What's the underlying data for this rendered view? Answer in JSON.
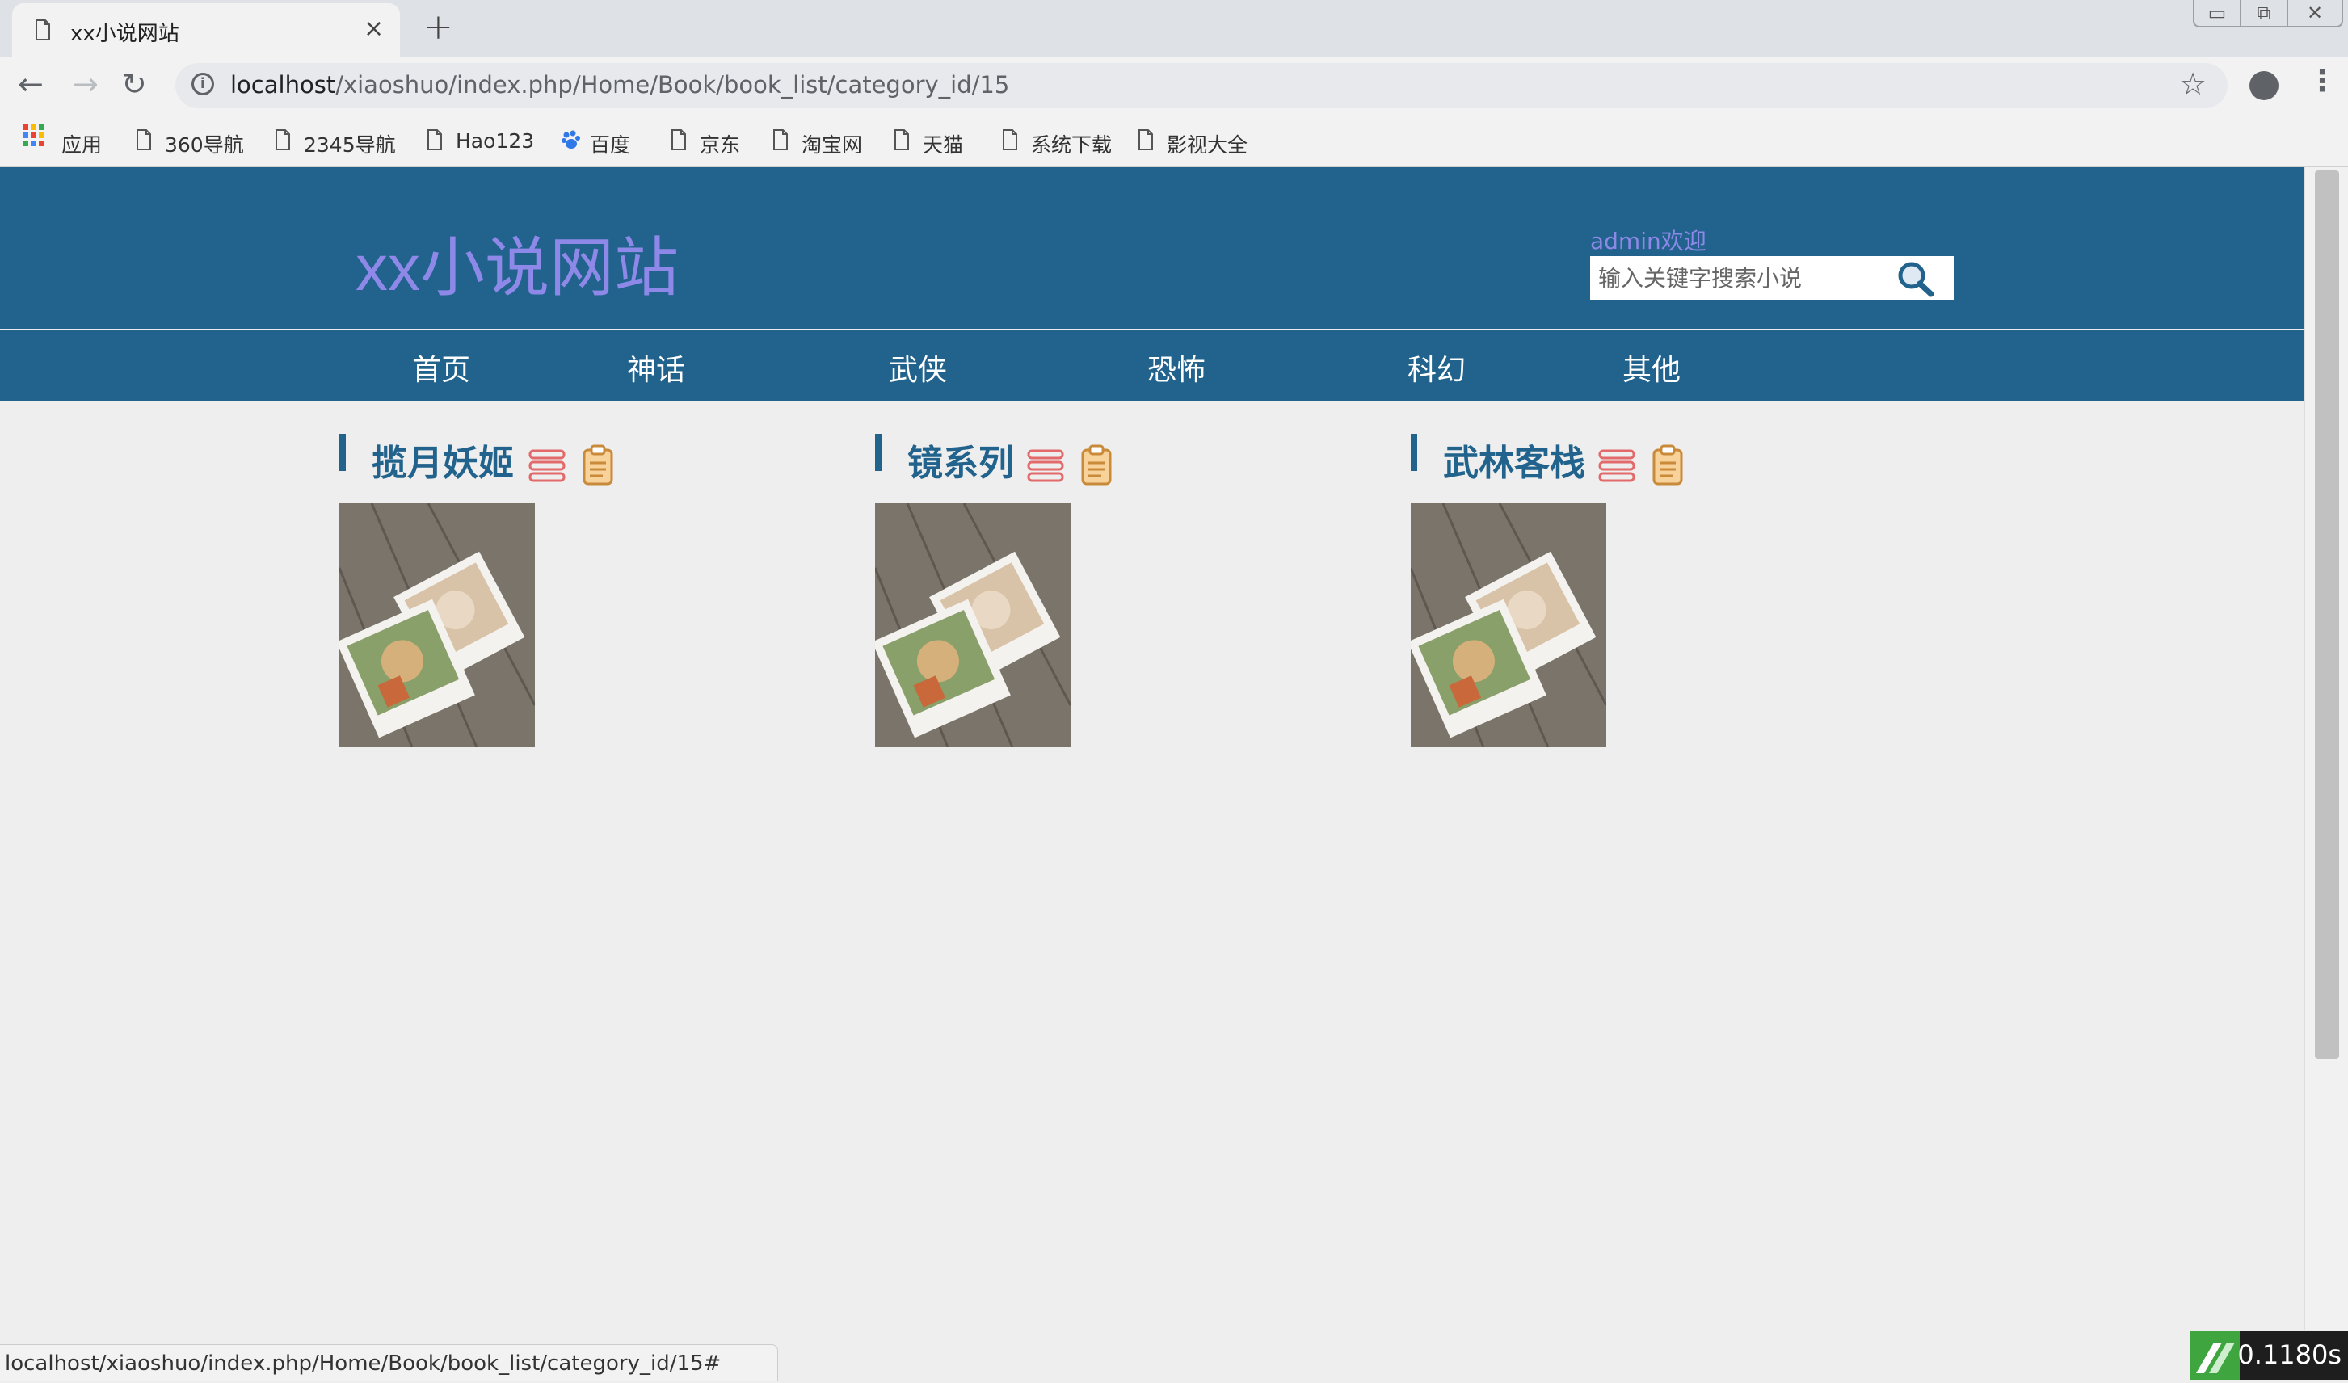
{
  "browser": {
    "tab_title": "xx小说网站",
    "tab_close": "×",
    "new_tab": "+",
    "url_host": "localhost",
    "url_path": "/xiaoshuo/index.php/Home/Book/book_list/category_id/15",
    "bookmarks": [
      {
        "label": "应用",
        "icon": "apps-grid-icon"
      },
      {
        "label": "360导航",
        "icon": "page-icon"
      },
      {
        "label": "2345导航",
        "icon": "page-icon"
      },
      {
        "label": "Hao123",
        "icon": "page-icon"
      },
      {
        "label": "百度",
        "icon": "baidu-paw-icon"
      },
      {
        "label": "京东",
        "icon": "page-icon"
      },
      {
        "label": "淘宝网",
        "icon": "page-icon"
      },
      {
        "label": "天猫",
        "icon": "page-icon"
      },
      {
        "label": "系统下载",
        "icon": "page-icon"
      },
      {
        "label": "影视大全",
        "icon": "page-icon"
      }
    ]
  },
  "site": {
    "title": "xx小说网站",
    "welcome": "admin欢迎",
    "search_placeholder": "输入关键字搜索小说",
    "nav": [
      "首页",
      "神话",
      "武侠",
      "恐怖",
      "科幻",
      "其他"
    ],
    "books": [
      {
        "title": "揽月妖姬"
      },
      {
        "title": "镜系列"
      },
      {
        "title": "武林客栈"
      }
    ]
  },
  "status": {
    "link_url": "localhost/xiaoshuo/index.php/Home/Book/book_list/category_id/15#",
    "timer": "0.1180s"
  },
  "colors": {
    "header_bg": "#21638c",
    "title_color": "#8e88e8",
    "page_bg": "#eeeeee"
  }
}
